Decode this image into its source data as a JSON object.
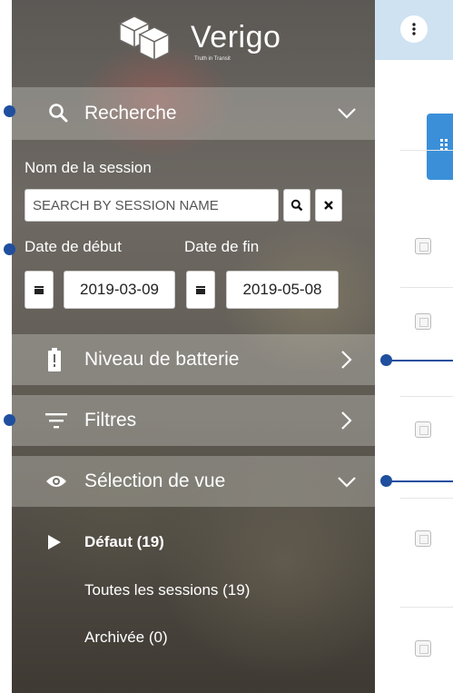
{
  "app": {
    "name": "Verigo",
    "tagline": "Truth in Transit"
  },
  "search_section": {
    "title": "Recherche",
    "icon": "search-icon",
    "chevron": "chevron-down-icon"
  },
  "session": {
    "label": "Nom de la session",
    "placeholder": "SEARCH BY SESSION NAME",
    "search_btn_icon": "search-icon",
    "clear_btn_icon": "close-icon"
  },
  "dates": {
    "start_label": "Date de début",
    "end_label": "Date de fin",
    "start_value": "2019-03-09",
    "end_value": "2019-05-08",
    "calendar_icon": "calendar-icon"
  },
  "battery_section": {
    "title": "Niveau de batterie",
    "icon": "battery-icon",
    "chevron": "chevron-right-icon"
  },
  "filters_section": {
    "title": "Filtres",
    "icon": "filter-icon",
    "chevron": "chevron-right-icon"
  },
  "view_section": {
    "title": "Sélection de vue",
    "icon": "eye-icon",
    "chevron": "chevron-down-icon"
  },
  "view_items": [
    {
      "label": "Défaut (19)",
      "selected": true
    },
    {
      "label": "Toutes les sessions (19)",
      "selected": false
    },
    {
      "label": "Archivée (0)",
      "selected": false
    }
  ],
  "colors": {
    "accent_blue": "#3b8fd8",
    "callout_blue": "#1f4f9e",
    "topbar": "#cfe2f2"
  }
}
